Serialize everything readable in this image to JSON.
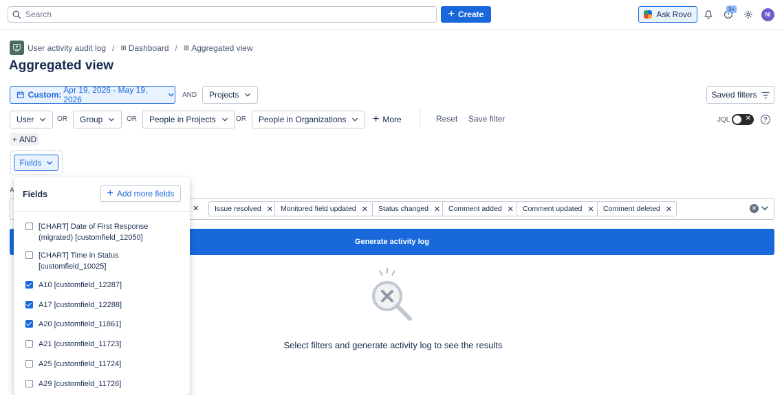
{
  "topbar": {
    "search_placeholder": "Search",
    "create_label": "Create",
    "ask_rovo_label": "Ask Rovo",
    "notifications_badge": "3+",
    "avatar_initials": "NI"
  },
  "breadcrumb": {
    "items": [
      "User activity audit log",
      "Dashboard",
      "Aggregated view"
    ]
  },
  "page_title": "Aggregated view",
  "filters": {
    "date_prefix": "Custom:",
    "date_range": "Apr 19, 2026 - May 19, 2026",
    "and_label": "AND",
    "or_label": "OR",
    "projects": "Projects",
    "user": "User",
    "group": "Group",
    "people_in_projects": "People in Projects",
    "people_in_organizations": "People in Organizations",
    "more": "More",
    "reset": "Reset",
    "save_filter": "Save filter",
    "saved_filters": "Saved filters",
    "jql_label": "JQL",
    "add_and": "AND",
    "fields": "Fields"
  },
  "activities": {
    "label": "A",
    "tags": [
      "Issue resolved",
      "Monitored field updated",
      "Status changed",
      "Comment added",
      "Comment updated",
      "Comment deleted"
    ]
  },
  "generate_label": "Generate activity log",
  "empty_state": {
    "message": "Select filters and generate activity log to see the results"
  },
  "fields_panel": {
    "title": "Fields",
    "add_more_label": "Add more fields",
    "options": [
      {
        "label": "[CHART] Date of First Response (migrated) [customfield_12050]",
        "checked": false
      },
      {
        "label": "[CHART] Time in Status [customfield_10025]",
        "checked": false
      },
      {
        "label": "A10 [customfield_12287]",
        "checked": true
      },
      {
        "label": "A17 [customfield_12288]",
        "checked": true
      },
      {
        "label": "A20 [customfield_11861]",
        "checked": true
      },
      {
        "label": "A21 [customfield_11723]",
        "checked": false
      },
      {
        "label": "A25 [customfield_11724]",
        "checked": false
      },
      {
        "label": "A29 [customfield_11726]",
        "checked": false
      }
    ]
  },
  "colors": {
    "primary": "#1868db",
    "primary_light": "#e9f2ff",
    "text": "#172b4d",
    "border": "#c1c7d0"
  }
}
